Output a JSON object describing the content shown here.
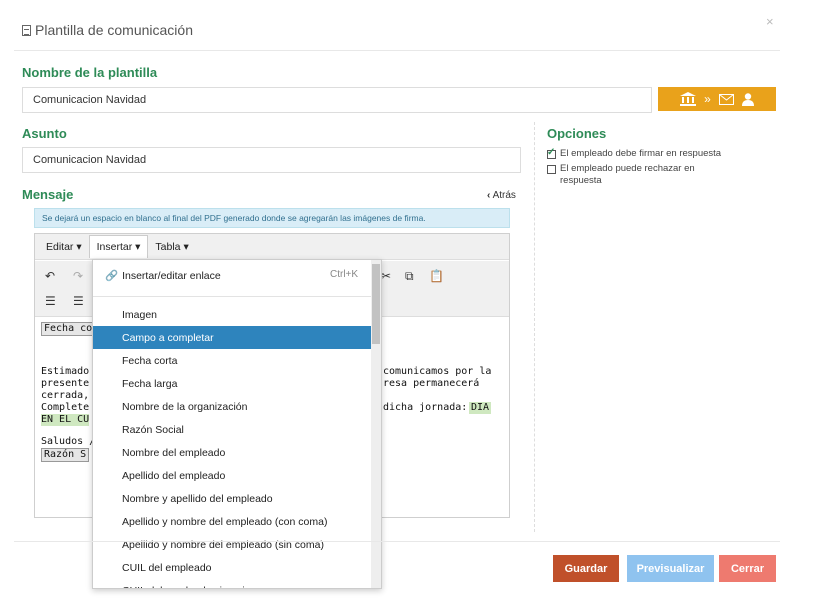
{
  "modal": {
    "title": "Plantilla de comunicación",
    "close": "×"
  },
  "template_name": {
    "label": "Nombre de la plantilla",
    "value": "Comunicacion Navidad"
  },
  "subject": {
    "label": "Asunto",
    "value": "Comunicacion Navidad"
  },
  "message": {
    "label": "Mensaje",
    "back": "Atrás",
    "info": "Se dejará un espacio en blanco al final del PDF generado donde se agregarán las imágenes de firma."
  },
  "options": {
    "title": "Opciones",
    "items": [
      {
        "label": "El empleado debe firmar en respuesta",
        "checked": true
      },
      {
        "label": "El empleado puede rechazar en respuesta",
        "checked": false
      }
    ]
  },
  "editor": {
    "menus": [
      "Editar ▾",
      "Insertar ▾",
      "Tabla ▾"
    ],
    "content": {
      "l1": "Fecha co",
      "l2a": "Estimado",
      "l2b": "comunicamos por la",
      "l3a": "presente",
      "l3b": "resa permanecerá",
      "l4": "cerrada,",
      "l5a": "Complete",
      "l5b": "dicha jornada:",
      "l5c": "DIA",
      "l6": "EN EL CU",
      "l7": "Saludos /",
      "l8": "Razón S"
    }
  },
  "insert_menu": {
    "link_label": "Insertar/editar enlace",
    "link_shortcut": "Ctrl+K",
    "items": [
      "Imagen",
      "Campo a completar",
      "Fecha corta",
      "Fecha larga",
      "Nombre de la organización",
      "Razón Social",
      "Nombre del empleado",
      "Apellido del empleado",
      "Nombre y apellido del empleado",
      "Apellido y nombre del empleado (con coma)",
      "Apellido y nombre del empleado (sin coma)",
      "CUIL del empleado",
      "CUIL del empleado sin guiones"
    ],
    "highlighted": "Campo a completar"
  },
  "buttons": {
    "save": "Guardar",
    "preview": "Previsualizar",
    "close": "Cerrar"
  },
  "colors": {
    "accent_green": "#2e8b57",
    "warning": "#e9a21b",
    "save": "#c0502a",
    "preview": "#8fc3ef",
    "close": "#ee7a6f",
    "highlight": "#2e84bd"
  }
}
